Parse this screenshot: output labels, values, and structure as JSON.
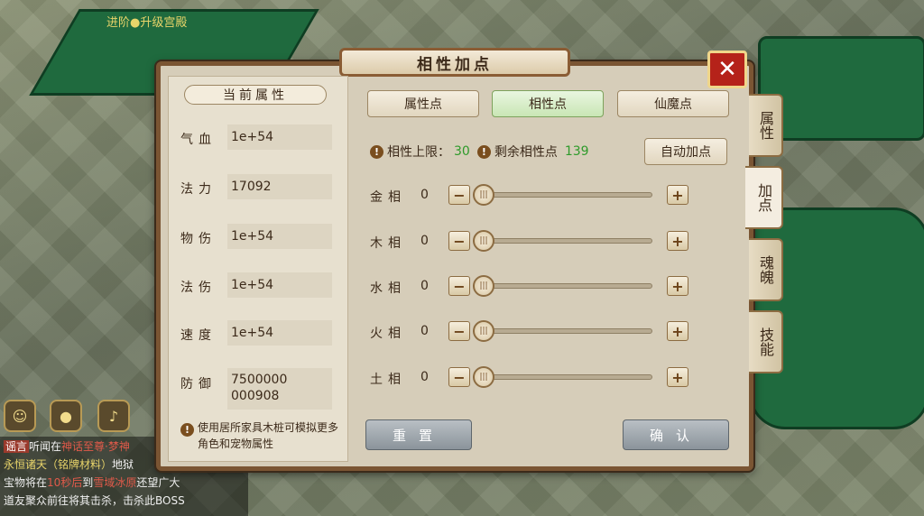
{
  "background": {
    "top_text": "进阶●升级宫殿",
    "chat": {
      "tag": "谣言",
      "line1_prefix": "听闻在",
      "line1_highlight": "神话至尊·梦神",
      "line2_highlight": "永恒诸天（铭牌材料）",
      "line2_suffix": "地狱",
      "line3_prefix": "宝物将在",
      "line3_time": "10秒后",
      "line3_mid": "到",
      "line3_place": "雪域冰原",
      "line3_suffix": "还望广大",
      "line4": "道友聚众前往将其击杀，击杀此BOSS"
    }
  },
  "panel": {
    "title": "相性加点",
    "close_label": "✕"
  },
  "left": {
    "header": "当前属性",
    "attributes": [
      {
        "label": "气血",
        "value": "1e+54"
      },
      {
        "label": "法力",
        "value": "17092"
      },
      {
        "label": "物伤",
        "value": "1e+54"
      },
      {
        "label": "法伤",
        "value": "1e+54"
      },
      {
        "label": "速度",
        "value": "1e+54"
      },
      {
        "label": "防御",
        "value": "7500000\n000908"
      }
    ],
    "note": "使用居所家具木桩可模拟更多角色和宠物属性"
  },
  "tabs": [
    "属性点",
    "相性点",
    "仙魔点"
  ],
  "active_tab": 1,
  "limit": {
    "cap_label": "相性上限：",
    "cap_value": "30",
    "remain_label": "剩余相性点",
    "remain_value": "139",
    "auto_button": "自动加点"
  },
  "elements": [
    {
      "label": "金相",
      "value": "0",
      "level": 0
    },
    {
      "label": "木相",
      "value": "0",
      "level": 0
    },
    {
      "label": "水相",
      "value": "0",
      "level": 0
    },
    {
      "label": "火相",
      "value": "0",
      "level": 0
    },
    {
      "label": "土相",
      "value": "0",
      "level": 0
    }
  ],
  "buttons": {
    "reset": "重置",
    "confirm": "确认"
  },
  "side_tabs": [
    "属性",
    "加点",
    "魂魄",
    "技能"
  ],
  "side_active": 1,
  "icons": {
    "info": "!",
    "minus": "−",
    "plus": "+",
    "knob": "|||"
  }
}
